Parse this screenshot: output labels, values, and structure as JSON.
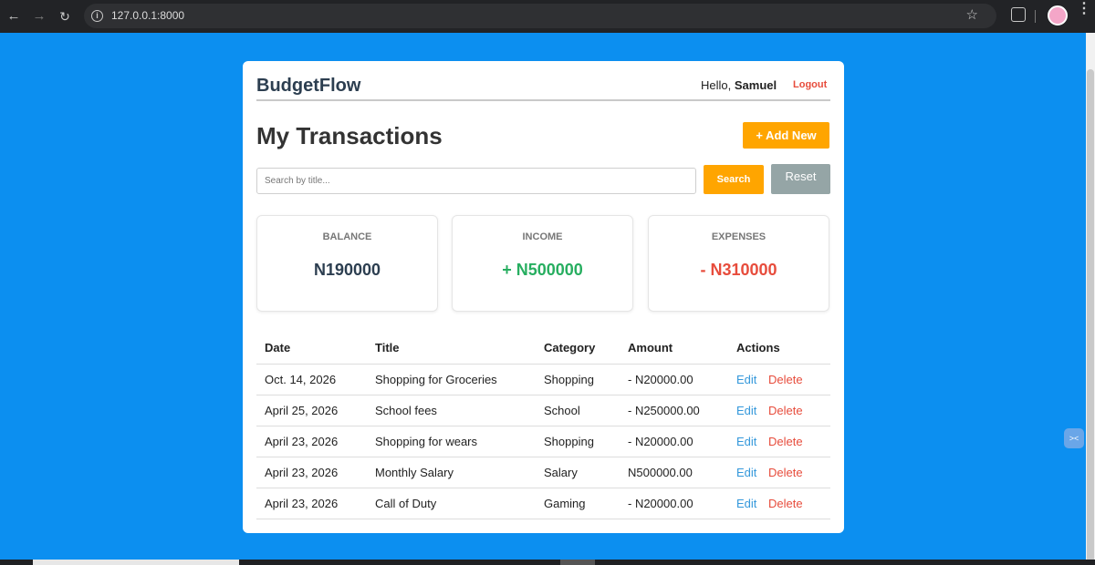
{
  "browser": {
    "url": "127.0.0.1:8000"
  },
  "header": {
    "brand": "BudgetFlow",
    "greeting": "Hello,",
    "username": "Samuel",
    "logout": "Logout"
  },
  "page": {
    "title": "My Transactions",
    "add_button": "+ Add New"
  },
  "search": {
    "placeholder": "Search by title...",
    "value": "",
    "search_button": "Search",
    "reset_button": "Reset"
  },
  "summary": {
    "balance": {
      "label": "BALANCE",
      "value": "N190000"
    },
    "income": {
      "label": "INCOME",
      "value": "+ N500000"
    },
    "expenses": {
      "label": "EXPENSES",
      "value": "- N310000"
    }
  },
  "table": {
    "columns": [
      "Date",
      "Title",
      "Category",
      "Amount",
      "Actions"
    ],
    "rows": [
      {
        "date": "Oct. 14, 2026",
        "title": "Shopping for Groceries",
        "category": "Shopping",
        "amount": "- N20000.00",
        "type": "expense",
        "edit": "Edit",
        "delete": "Delete"
      },
      {
        "date": "April 25, 2026",
        "title": "School fees",
        "category": "School",
        "amount": "- N250000.00",
        "type": "expense",
        "edit": "Edit",
        "delete": "Delete"
      },
      {
        "date": "April 23, 2026",
        "title": "Shopping for wears",
        "category": "Shopping",
        "amount": "- N20000.00",
        "type": "expense",
        "edit": "Edit",
        "delete": "Delete"
      },
      {
        "date": "April 23, 2026",
        "title": "Monthly Salary",
        "category": "Salary",
        "amount": "N500000.00",
        "type": "income",
        "edit": "Edit",
        "delete": "Delete"
      },
      {
        "date": "April 23, 2026",
        "title": "Call of Duty",
        "category": "Gaming",
        "amount": "- N20000.00",
        "type": "expense",
        "edit": "Edit",
        "delete": "Delete"
      }
    ]
  },
  "colors": {
    "page_background": "#0c8ff0",
    "accent_orange": "#ffa500",
    "income_green": "#27ae60",
    "expense_red": "#e74c3c",
    "link_blue": "#3498db"
  }
}
